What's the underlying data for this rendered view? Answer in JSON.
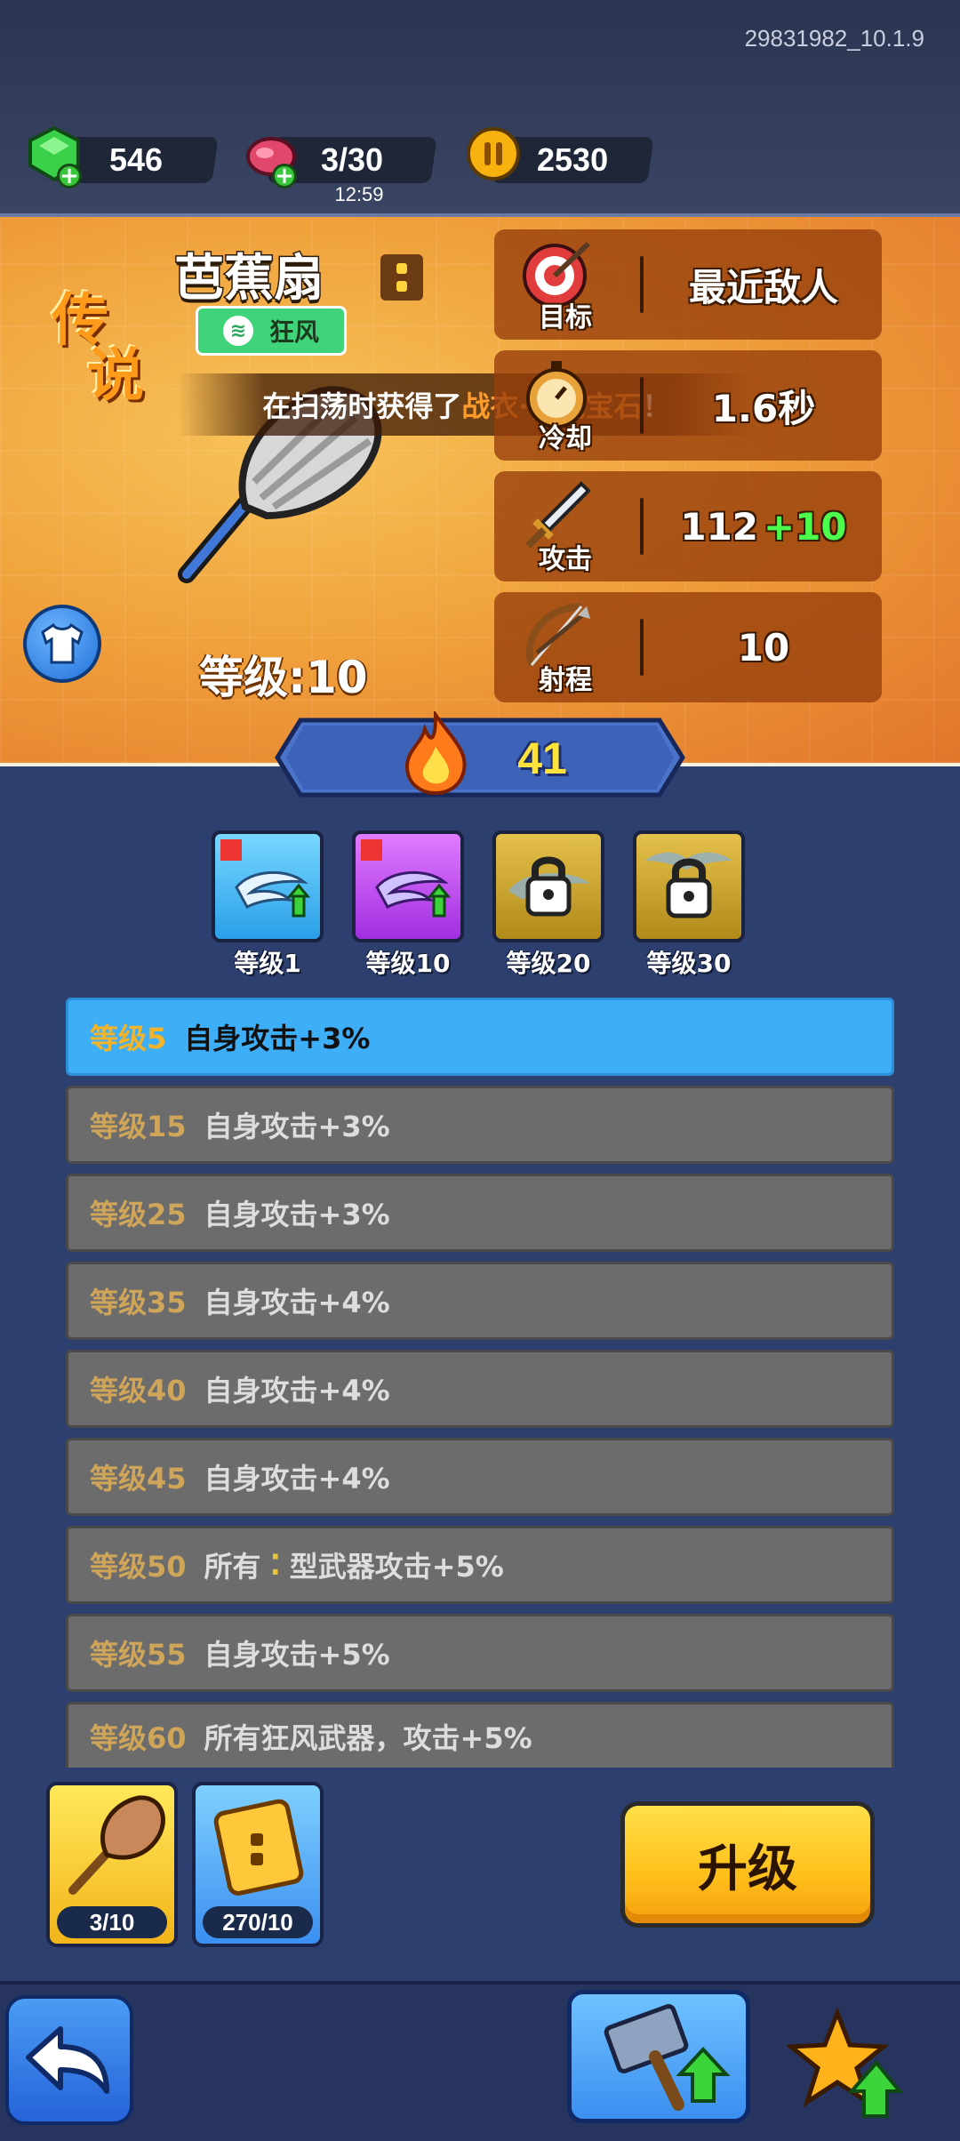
{
  "version": "29831982_10.1.9",
  "resources": {
    "gems": "546",
    "energy": "3/30",
    "energy_timer": "12:59",
    "coins": "2530"
  },
  "weapon": {
    "rarity_line1": "传",
    "rarity_line2": "说",
    "name": "芭蕉扇",
    "type": "狂风",
    "level_label": "等级:10"
  },
  "banner": {
    "prefix": "在扫荡时获得了 ",
    "highlight": "战衣·传说宝石",
    "suffix": "！"
  },
  "stats": [
    {
      "label": "目标",
      "value": "最近敌人",
      "bonus": "",
      "icon": "target-icon"
    },
    {
      "label": "冷却",
      "value": "1.6秒",
      "bonus": "",
      "icon": "stopwatch-icon"
    },
    {
      "label": "攻击",
      "value": "112",
      "bonus": "+10",
      "icon": "sword-icon"
    },
    {
      "label": "射程",
      "value": "10",
      "bonus": "",
      "icon": "bow-icon"
    }
  ],
  "power": "41",
  "skills": [
    {
      "label": "等级1",
      "locked": false
    },
    {
      "label": "等级10",
      "locked": false
    },
    {
      "label": "等级20",
      "locked": true
    },
    {
      "label": "等级30",
      "locked": true
    }
  ],
  "perks": [
    {
      "level": "等级5",
      "text": "自身攻击+3%",
      "active": true
    },
    {
      "level": "等级15",
      "text": "自身攻击+3%",
      "active": false
    },
    {
      "level": "等级25",
      "text": "自身攻击+3%",
      "active": false
    },
    {
      "level": "等级35",
      "text": "自身攻击+4%",
      "active": false
    },
    {
      "level": "等级40",
      "text": "自身攻击+4%",
      "active": false
    },
    {
      "level": "等级45",
      "text": "自身攻击+4%",
      "active": false
    },
    {
      "level": "等级50",
      "text_a": "所有",
      "text_b": "型武器攻击+5%",
      "active": false
    },
    {
      "level": "等级55",
      "text": "自身攻击+5%",
      "active": false
    },
    {
      "level": "等级60",
      "text": "所有狂风武器，攻击+5%",
      "active": false
    }
  ],
  "items": [
    {
      "count": "3/10",
      "progress": 0.3
    },
    {
      "count": "270/10",
      "progress": 1.0
    }
  ],
  "upgrade_label": "升级",
  "colors": {
    "accent_blue": "#3eaef7",
    "upgrade_yellow": "#ffc21d",
    "bonus_green": "#4dff4d",
    "type_green": "#3fd37a"
  }
}
